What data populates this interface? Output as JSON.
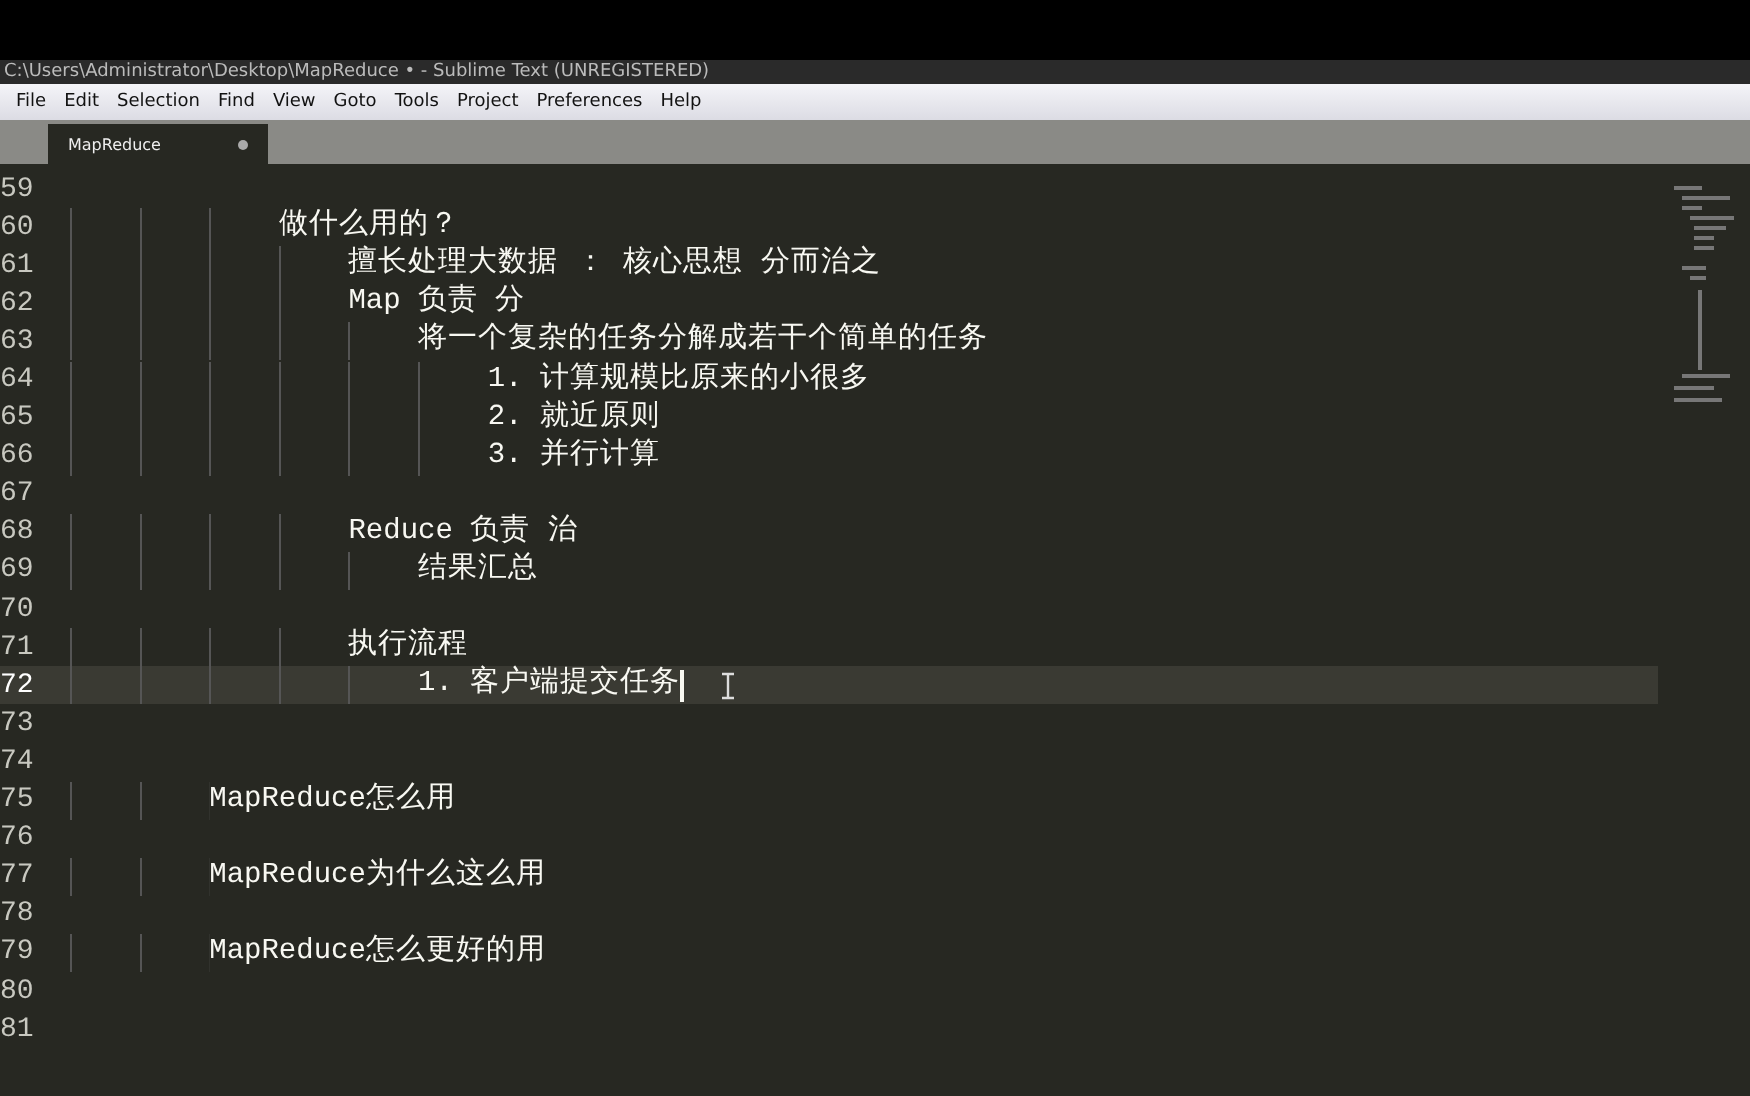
{
  "window": {
    "title": "C:\\Users\\Administrator\\Desktop\\MapReduce • - Sublime Text (UNREGISTERED)"
  },
  "menu": [
    "File",
    "Edit",
    "Selection",
    "Find",
    "View",
    "Goto",
    "Tools",
    "Project",
    "Preferences",
    "Help"
  ],
  "tabs": [
    {
      "label": "MapReduce",
      "selected": true,
      "modified": true
    }
  ],
  "editor": {
    "lines": [
      {
        "number": "59",
        "current": false
      },
      {
        "number": "60",
        "text": "            做什么用的？",
        "current": false
      },
      {
        "number": "61",
        "text": "                擅长处理大数据 ： 核心思想 分而治之",
        "current": false
      },
      {
        "number": "62",
        "text": "                Map 负责 分",
        "current": false
      },
      {
        "number": "63",
        "text": "                    将一个复杂的任务分解成若干个简单的任务",
        "current": false
      },
      {
        "number": "64",
        "text": "                        1. 计算规模比原来的小很多",
        "current": false
      },
      {
        "number": "65",
        "text": "                        2. 就近原则",
        "current": false
      },
      {
        "number": "66",
        "text": "                        3. 并行计算",
        "current": false
      },
      {
        "number": "67",
        "current": false
      },
      {
        "number": "68",
        "text": "                Reduce 负责 治",
        "current": false
      },
      {
        "number": "69",
        "text": "                    结果汇总",
        "current": false
      },
      {
        "number": "70",
        "current": false
      },
      {
        "number": "71",
        "text": "                执行流程",
        "current": false
      },
      {
        "number": "72",
        "text": "                    1. 客户端提交任务",
        "current": true
      },
      {
        "number": "73",
        "current": false
      },
      {
        "number": "74",
        "current": false
      },
      {
        "number": "75",
        "text": "        MapReduce怎么用",
        "current": false
      },
      {
        "number": "76",
        "current": false
      },
      {
        "number": "77",
        "text": "        MapReduce为什么这么用",
        "current": false
      },
      {
        "number": "78",
        "current": false
      },
      {
        "number": "79",
        "text": "        MapReduce怎么更好的用",
        "current": false
      },
      {
        "number": "80",
        "current": false
      },
      {
        "number": "81",
        "current": false
      }
    ]
  }
}
